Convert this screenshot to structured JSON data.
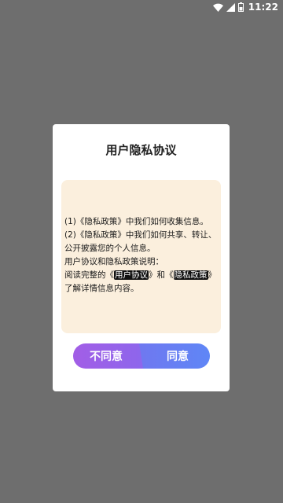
{
  "status_bar": {
    "time": "11:22",
    "icons": [
      "wifi-icon",
      "signal-icon",
      "battery-icon"
    ]
  },
  "dialog": {
    "title": "用户隐私协议",
    "content": {
      "line1": "(1)《隐私政策》中我们如何收集信息。",
      "line2": "(2)《隐私政策》中我们如何共享、转让、公开披露您的个人信息。",
      "line3": "用户协议和隐私政策说明：",
      "line4_prefix": "阅读完整的《",
      "user_agreement_link": "用户协议",
      "line4_middle": "》和《",
      "privacy_policy_link": "隐私政策",
      "line4_suffix": "》了解详情信息内容。"
    },
    "buttons": {
      "disagree": "不同意",
      "agree": "同意"
    }
  },
  "colors": {
    "backdrop": "#6e6e6e",
    "content_bg": "#fbefdd",
    "disagree_gradient": [
      "#a25ee6",
      "#8d66ec"
    ],
    "agree_gradient": [
      "#6f78f0",
      "#5f86f6"
    ]
  }
}
